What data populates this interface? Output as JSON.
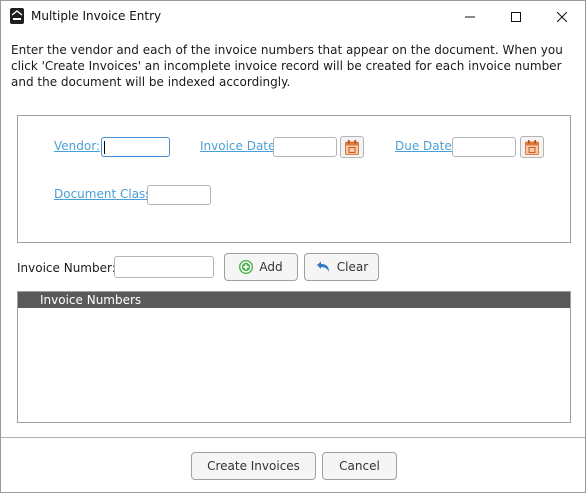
{
  "window": {
    "title": "Multiple Invoice Entry"
  },
  "instructions": "Enter the vendor and each of the invoice numbers that appear on the document. When you click 'Create Invoices' an incomplete invoice record will be created for each invoice number and the document will be indexed accordingly.",
  "criteria": {
    "vendor_label": "Vendor:",
    "vendor_value": "",
    "invoice_date_label": "Invoice Date:",
    "invoice_date_value": "",
    "due_date_label": "Due Date:",
    "due_date_value": "",
    "document_class_label": "Document Class:",
    "document_class_value": ""
  },
  "invoice_entry": {
    "label": "Invoice Number:",
    "value": "",
    "add_label": "Add",
    "clear_label": "Clear"
  },
  "invoice_list": {
    "header": "Invoice Numbers",
    "items": []
  },
  "footer": {
    "create_label": "Create Invoices",
    "cancel_label": "Cancel"
  },
  "colors": {
    "link": "#4a9fd8",
    "list_header_bg": "#5a5a5a",
    "calendar_icon": "#e07a3c",
    "add_icon": "#4caf50",
    "clear_icon": "#2f78c4"
  },
  "icons": {
    "app": "app-logo-icon",
    "calendar": "calendar-icon",
    "add": "plus-circle-icon",
    "clear": "undo-arrow-icon"
  }
}
